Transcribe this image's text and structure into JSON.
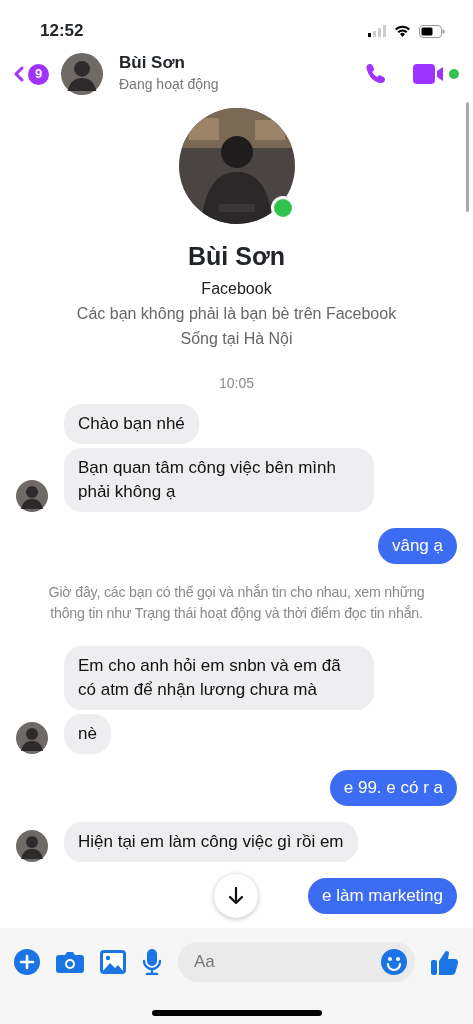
{
  "status_bar": {
    "time": "12:52"
  },
  "header": {
    "back_count": "9",
    "name": "Bùi Sơn",
    "status": "Đang hoạt động",
    "online": true
  },
  "profile": {
    "name": "Bùi Sơn",
    "online": true,
    "lines": [
      "Facebook",
      "Các bạn không phải là bạn bè trên Facebook",
      "Sống tại Hà Nội"
    ]
  },
  "messages": [
    {
      "kind": "time",
      "text": "10:05"
    },
    {
      "kind": "incoming",
      "text": "Chào bạn nhé",
      "avatar": false
    },
    {
      "kind": "incoming",
      "text": "Bạn quan tâm công việc bên mình phải không ạ",
      "avatar": true
    },
    {
      "kind": "outgoing",
      "text": "vâng ạ"
    },
    {
      "kind": "notice",
      "text": "Giờ đây, các bạn có thể gọi và nhắn tin cho nhau, xem những thông tin như Trạng thái hoạt động và thời điểm đọc tin nhắn."
    },
    {
      "kind": "incoming",
      "text": "Em cho anh hỏi em snbn và em đã có atm để nhận lương chưa mà",
      "avatar": false
    },
    {
      "kind": "incoming",
      "text": "nè",
      "avatar": true
    },
    {
      "kind": "outgoing",
      "text": "e 99. e có r a"
    },
    {
      "kind": "incoming",
      "text": "Hiện tại em làm công việc gì rồi em",
      "avatar": true
    },
    {
      "kind": "outgoing",
      "text": "e làm marketing"
    }
  ],
  "composer": {
    "placeholder": "Aa"
  }
}
